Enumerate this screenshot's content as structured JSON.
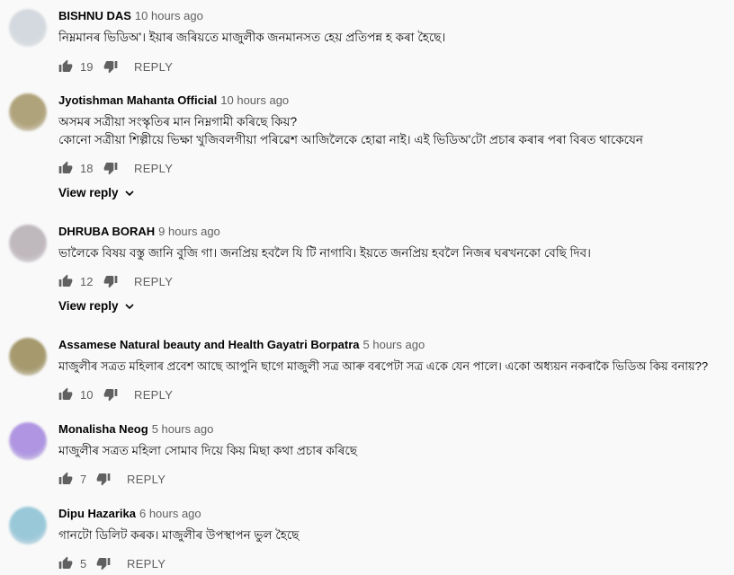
{
  "comments": [
    {
      "author": "BISHNU DAS",
      "time": "10 hours ago",
      "lines": [
        "নিম্নমানৰ ভিডিঅ'। ইয়াৰ জৰিয়তে মাজুলীক জনমানসত হেয় প্ৰতিপন্ন হ কৰা হৈছে।"
      ],
      "likes": "19",
      "reply_label": "REPLY",
      "avatar_color": "#cfd6dc"
    },
    {
      "author": "Jyotishman Mahanta Official",
      "time": "10 hours ago",
      "lines": [
        "অসমৰ সত্ৰীয়া সংস্কৃতিৰ মান নিম্নগামী কৰিছে কিয়?",
        "কোনো সত্ৰীয়া শিল্পীয়ে ভিক্ষা খুজিবলগীয়া পৰিৱেশ আজিলৈকে হোৱা নাই। এই ভিডিঅ'টো প্ৰচাৰ কৰাৰ পৰা বিৰত থাকেযেন"
      ],
      "likes": "18",
      "reply_label": "REPLY",
      "view_reply": "View reply",
      "avatar_color": "#a89a6e"
    },
    {
      "author": "DHRUBA BORAH",
      "time": "9 hours ago",
      "lines": [
        "ভালৈকে বিষয় বস্তু জানি বুজি গা।  জনপ্ৰিয় হবলৈ যি টি নাগাবি। ইয়তে জনপ্ৰিয় হবলৈ নিজৰ ঘৰখনকো বেছি দিব।"
      ],
      "likes": "12",
      "reply_label": "REPLY",
      "view_reply": "View reply",
      "avatar_color": "#b9b1b7"
    },
    {
      "author": "Assamese Natural beauty and Health Gayatri Borpatra",
      "time": "5 hours ago",
      "lines": [
        "মাজুলীৰ সত্ৰত মহিলাৰ প্ৰবেশ আছে আপুনি ছাগে মাজুলী সত্ৰ আৰু বৰপেটা সত্ৰ একে যেন পালে। একো অধ্যয়ন নকৰাকৈ ভিডিঅ কিয় বনায়??"
      ],
      "likes": "10",
      "reply_label": "REPLY",
      "avatar_color": "#9c8f5e"
    },
    {
      "author": "Monalisha Neog",
      "time": "5 hours ago",
      "lines": [
        "মাজুলীৰ সত্ৰত মহিলা সোমাব দিয়ে কিয় মিছা কথা প্ৰচাৰ কৰিছে"
      ],
      "likes": "7",
      "reply_label": "REPLY",
      "avatar_color": "#a78be0"
    },
    {
      "author": "Dipu Hazarika",
      "time": "6 hours ago",
      "lines": [
        "গানটো ডিলিট কৰক।  মাজুলীৰ উপস্থাপন ভুল হৈছে"
      ],
      "likes": "5",
      "reply_label": "REPLY",
      "avatar_color": "#8fc3d6"
    }
  ]
}
